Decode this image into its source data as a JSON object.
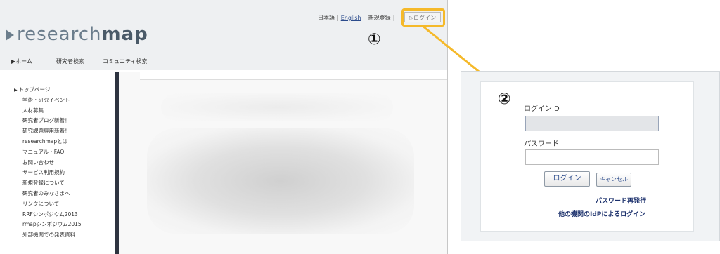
{
  "header": {
    "lang_ja": "日本語",
    "lang_en": "English",
    "register": "新規登録",
    "login": "▷ログイン",
    "logo_light": "research",
    "logo_bold": "map"
  },
  "nav": [
    "▶ホーム",
    "研究者検索",
    "コミュニティ検索"
  ],
  "sidebar": {
    "items": [
      "トップページ",
      "学術・研究イベント",
      "人材募集",
      "研究者ブログ新着！",
      "研究課題専用新着！",
      "researchmapとは",
      "マニュアル・FAQ",
      "お問い合わせ",
      "サービス利用規約",
      "新規登録について",
      "研究者のみなさまへ",
      "リンクについて",
      "RRFシンポジウム2013",
      "rmapシンポジウム2015",
      "外部機関での発表資料"
    ]
  },
  "annotations": {
    "step1": "①",
    "step2": "②"
  },
  "login_form": {
    "id_label": "ログインID",
    "id_value": "",
    "password_label": "パスワード",
    "password_value": "",
    "login_button": "ログイン",
    "cancel_button": "キャンセル",
    "reissue_link": "パスワード再発行",
    "idp_link": "他の機関のIdPによるログイン"
  },
  "colors": {
    "highlight": "#f5b92a",
    "sidebar_divider": "#2e3440",
    "link": "#1a2f6b"
  }
}
